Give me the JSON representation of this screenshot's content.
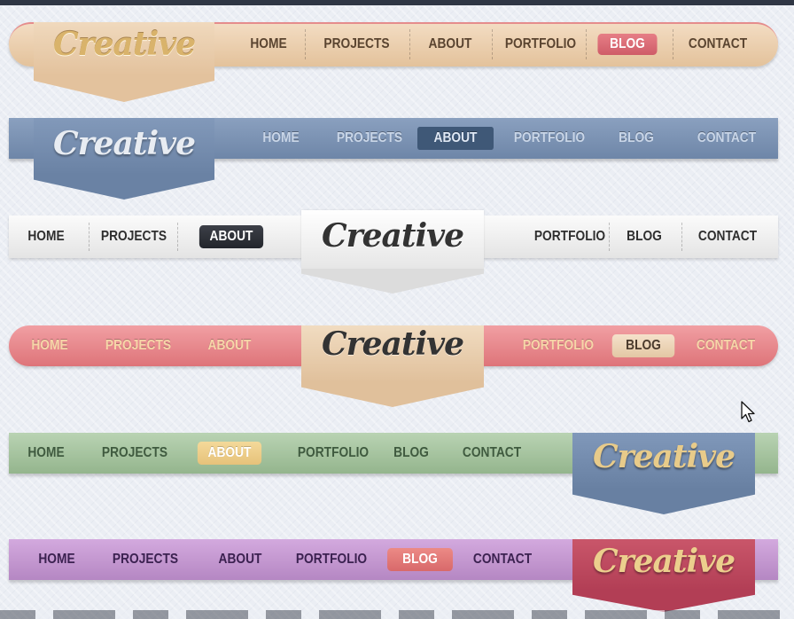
{
  "logo_text": "Creative",
  "colors": {
    "tan": "#e8caa6",
    "blue": "#7a8fb0",
    "grey": "#ededed",
    "pink": "#e68186",
    "green": "#a6c39f",
    "purple": "#c195cf",
    "crimson_ribbon": "#c24a5d",
    "gold_text": "#e6c98a"
  },
  "bars": [
    {
      "id": "tan-rounded",
      "items": [
        "HOME",
        "PROJECTS",
        "ABOUT",
        "PORTFOLIO",
        "BLOG",
        "CONTACT"
      ],
      "active": "BLOG",
      "logo_position": "left"
    },
    {
      "id": "blue-flat",
      "items": [
        "HOME",
        "PROJECTS",
        "ABOUT",
        "PORTFOLIO",
        "BLOG",
        "CONTACT"
      ],
      "active": "ABOUT",
      "logo_position": "left"
    },
    {
      "id": "grey-flat",
      "items": [
        "HOME",
        "PROJECTS",
        "ABOUT",
        "PORTFOLIO",
        "BLOG",
        "CONTACT"
      ],
      "active": "ABOUT",
      "logo_position": "center"
    },
    {
      "id": "pink-rounded",
      "items": [
        "HOME",
        "PROJECTS",
        "ABOUT",
        "PORTFOLIO",
        "BLOG",
        "CONTACT"
      ],
      "active": "BLOG",
      "logo_position": "center"
    },
    {
      "id": "green-flat",
      "items": [
        "HOME",
        "PROJECTS",
        "ABOUT",
        "PORTFOLIO",
        "BLOG",
        "CONTACT"
      ],
      "active": "ABOUT",
      "logo_position": "right"
    },
    {
      "id": "purple-flat",
      "items": [
        "HOME",
        "PROJECTS",
        "ABOUT",
        "PORTFOLIO",
        "BLOG",
        "CONTACT"
      ],
      "active": "BLOG",
      "logo_position": "right"
    }
  ],
  "cursor_icon": "mouse-pointer-icon"
}
